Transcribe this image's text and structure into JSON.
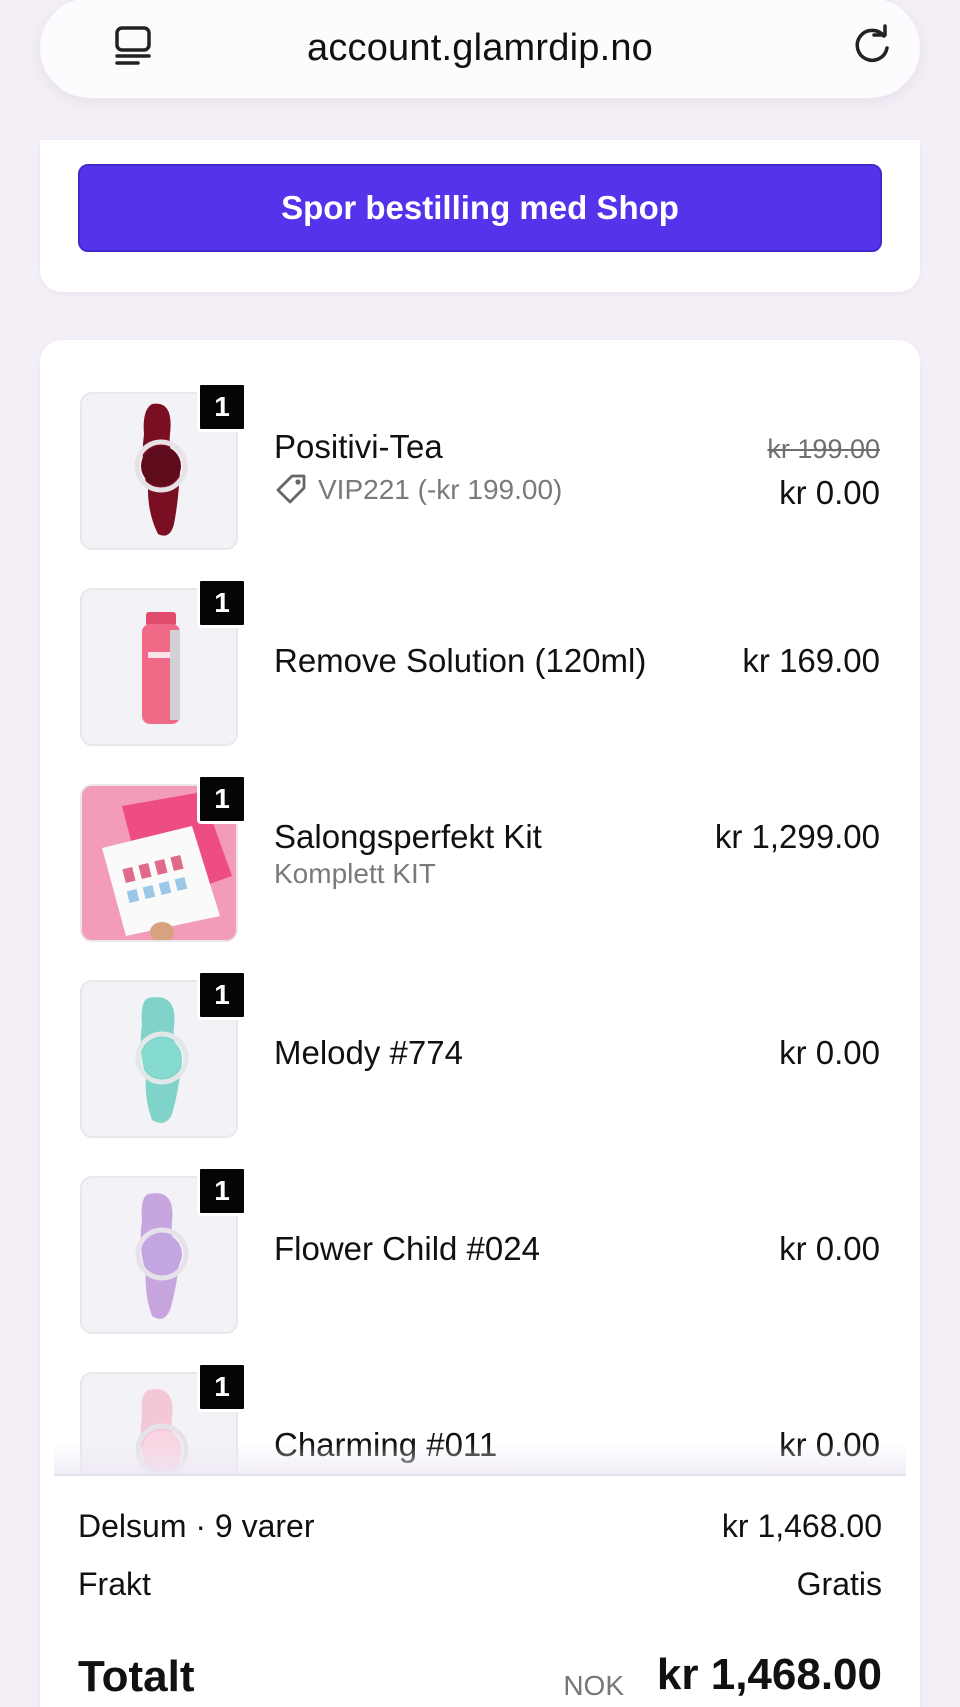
{
  "browser": {
    "url": "account.glamrdip.no",
    "left_icon": "tab-overview-icon",
    "reload_icon": "reload-icon"
  },
  "shop_button": {
    "label": "Spor bestilling med Shop",
    "color": "#5433eb"
  },
  "items": [
    {
      "name": "Positivi-Tea",
      "quantity": "1",
      "discount_code": "VIP221 (-kr 199.00)",
      "original_price": "kr 199.00",
      "price": "kr 0.00",
      "swatch_color": "#7a0f24"
    },
    {
      "name": "Remove Solution (120ml)",
      "quantity": "1",
      "price": "kr 169.00",
      "swatch_color": "#f06a88"
    },
    {
      "name": "Salongsperfekt Kit",
      "quantity": "1",
      "variant": "Komplett KIT",
      "price": "kr 1,299.00",
      "swatch_color": "#f29cb8"
    },
    {
      "name": "Melody #774",
      "quantity": "1",
      "price": "kr 0.00",
      "swatch_color": "#7fd3c9"
    },
    {
      "name": "Flower Child #024",
      "quantity": "1",
      "price": "kr 0.00",
      "swatch_color": "#c7a6e0"
    },
    {
      "name": "Charming #011",
      "quantity": "1",
      "price": "kr 0.00",
      "swatch_color": "#f4c7d6"
    }
  ],
  "summary": {
    "subtotal_label": "Delsum · 9 varer",
    "subtotal_value": "kr 1,468.00",
    "shipping_label": "Frakt",
    "shipping_value": "Gratis",
    "total_label": "Totalt",
    "currency": "NOK",
    "total_value": "kr 1,468.00"
  }
}
